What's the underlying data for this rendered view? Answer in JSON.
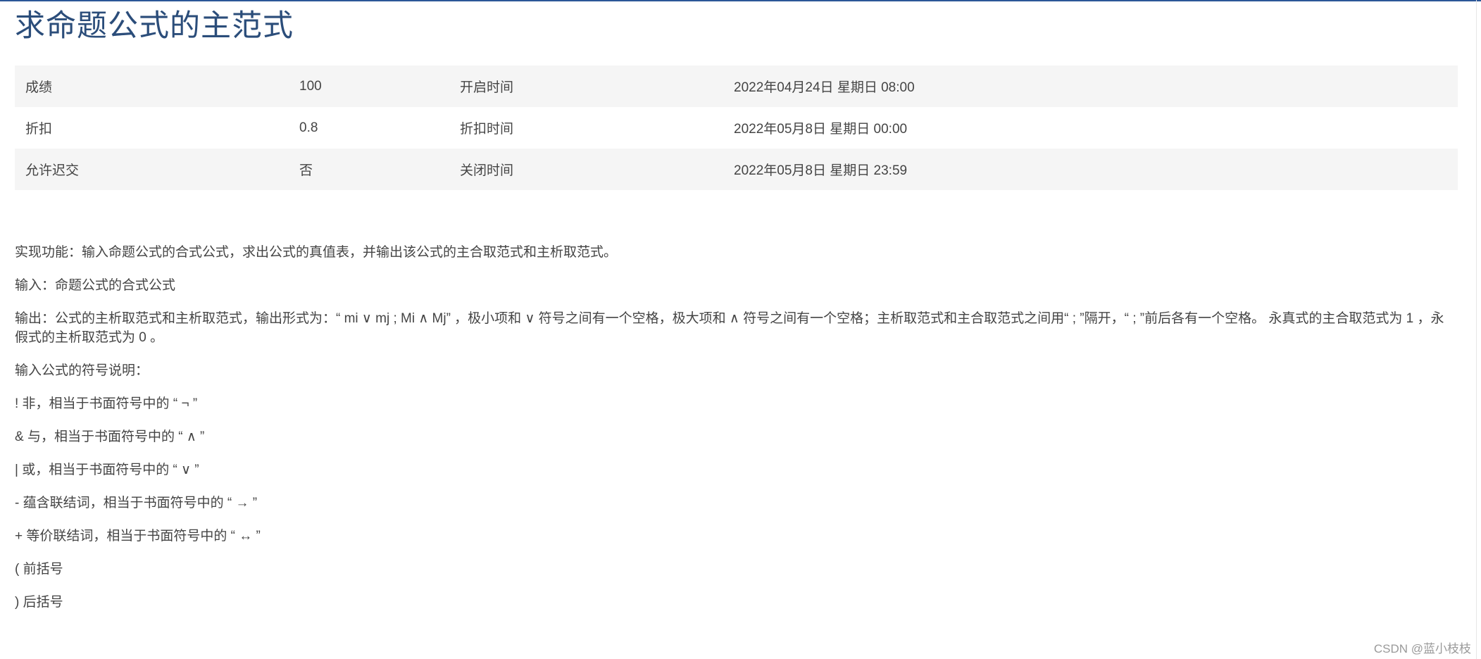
{
  "title": "求命题公式的主范式",
  "info": {
    "rows": [
      {
        "label": "成绩",
        "value": "100",
        "label2": "开启时间",
        "value2": "2022年04月24日 星期日 08:00"
      },
      {
        "label": "折扣",
        "value": "0.8",
        "label2": "折扣时间",
        "value2": "2022年05月8日 星期日 00:00"
      },
      {
        "label": "允许迟交",
        "value": "否",
        "label2": "关闭时间",
        "value2": "2022年05月8日 星期日 23:59"
      }
    ]
  },
  "description": {
    "function": "实现功能：输入命题公式的合式公式，求出公式的真值表，并输出该公式的主合取范式和主析取范式。",
    "input": "输入：命题公式的合式公式",
    "output": "输出：公式的主析取范式和主析取范式，输出形式为：“ mi ∨ mj ; Mi ∧ Mj” ，极小项和 ∨ 符号之间有一个空格，极大项和 ∧ 符号之间有一个空格；主析取范式和主合取范式之间用“ ; ”隔开，“ ; ”前后各有一个空格。 永真式的主合取范式为 1 ，永假式的主析取范式为 0 。",
    "symbols_heading": "输入公式的符号说明：",
    "symbols": [
      "! 非，相当于书面符号中的 “ ¬ ”",
      "& 与，相当于书面符号中的 “ ∧ ”",
      "| 或，相当于书面符号中的 “ ∨ ”",
      "- 蕴含联结词，相当于书面符号中的 “ → ”",
      "+ 等价联结词，相当于书面符号中的 “ ↔ ”",
      "( 前括号",
      ") 后括号"
    ]
  },
  "watermark": "CSDN @蓝小枝枝"
}
